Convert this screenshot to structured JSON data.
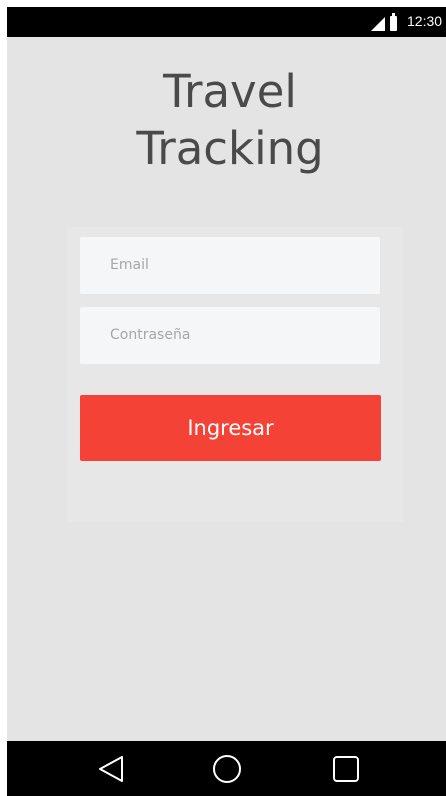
{
  "status_bar": {
    "time": "12:30",
    "icons": [
      "signal-icon",
      "battery-icon"
    ]
  },
  "app": {
    "title_line1": "Travel",
    "title_line2": "Tracking"
  },
  "login_form": {
    "email_placeholder": "Email",
    "password_placeholder": "Contraseña",
    "submit_label": "Ingresar"
  },
  "nav_bar": {
    "buttons": [
      "back-icon",
      "home-icon",
      "recents-icon"
    ]
  },
  "colors": {
    "background": "#e4e4e4",
    "input_background": "#f4f6f7",
    "submit_background": "#f44336",
    "title_text": "#4a4a4a",
    "bars": "#000000"
  }
}
